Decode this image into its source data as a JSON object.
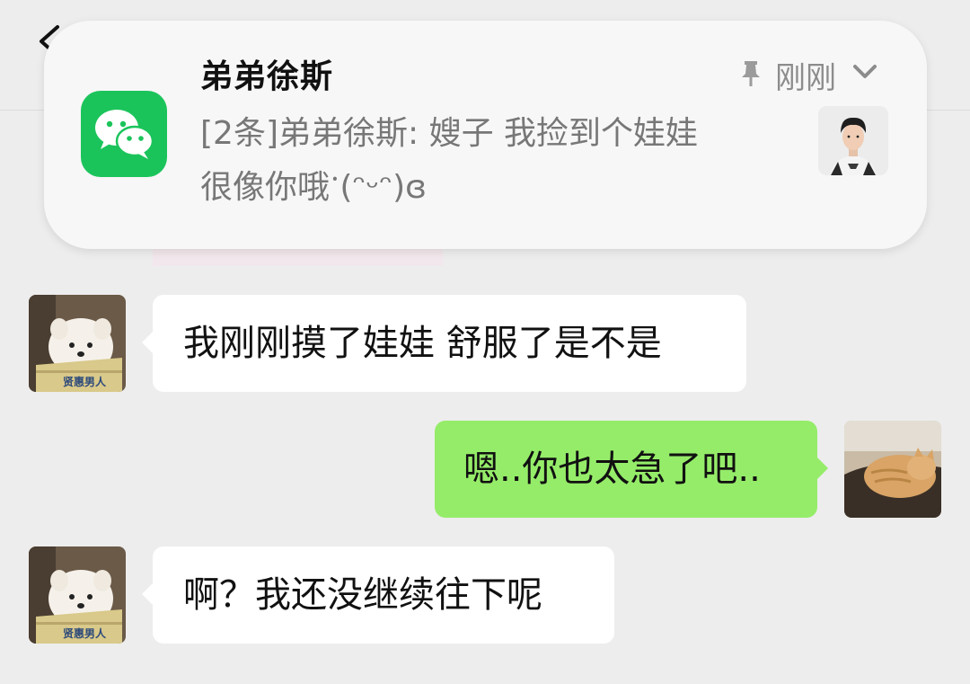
{
  "notification": {
    "app_icon": "wechat-icon",
    "sender": "弟弟徐斯",
    "time": "刚刚",
    "pin_icon": "pin-icon",
    "expand_icon": "chevron-down-icon",
    "preview_line1": "[2条]弟弟徐斯: 嫂子 我捡到个娃娃",
    "preview_line2": "很像你哦ॱ(ᵔᵕᵔ)ɞ",
    "colors": {
      "background": "#f7f7f7",
      "app_icon": "#1bc45b",
      "secondary_text": "#8c8c8c"
    }
  },
  "chat": {
    "messages": [
      {
        "side": "left",
        "text": "我刚刚摸了娃娃 舒服了是不是",
        "avatar_book_text": "贤惠男人"
      },
      {
        "side": "right",
        "text": "嗯..你也太急了吧.."
      },
      {
        "side": "left",
        "text": "啊？我还没继续往下呢",
        "avatar_book_text": "贤惠男人"
      }
    ],
    "colors": {
      "background": "#ededed",
      "incoming_bubble": "#ffffff",
      "outgoing_bubble": "#95ec69"
    }
  }
}
